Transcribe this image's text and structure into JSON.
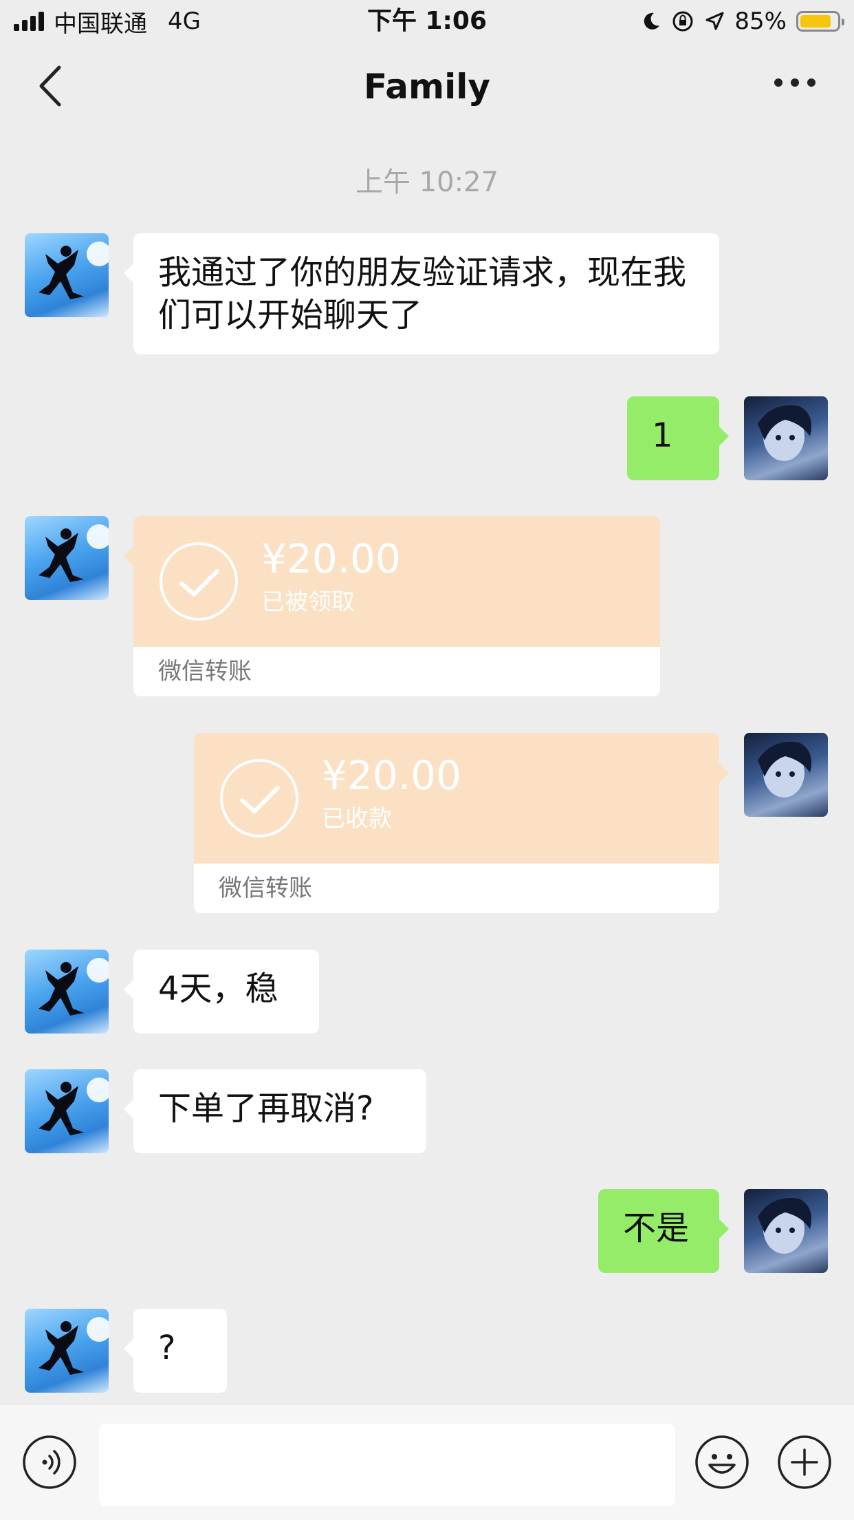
{
  "status_bar": {
    "carrier": "中国联通",
    "network": "4G",
    "time": "下午 1:06",
    "battery": "85%",
    "battery_level": 0.85,
    "icons": [
      "signal-icon",
      "moon-icon",
      "rotation-lock-icon",
      "location-icon",
      "battery-icon"
    ],
    "battery_color": "#f6c60d"
  },
  "nav": {
    "title": "Family",
    "back_icon": "chevron-left-icon",
    "more_icon": "more-icon"
  },
  "chat": {
    "timestamp": "上午 10:27",
    "messages": [
      {
        "from": "other",
        "type": "text",
        "text": "我通过了你的朋友验证请求，现在我们可以开始聊天了"
      },
      {
        "from": "me",
        "type": "text",
        "text": "1"
      },
      {
        "from": "other",
        "type": "transfer",
        "amount": "¥20.00",
        "status": "已被领取",
        "label": "微信转账"
      },
      {
        "from": "me",
        "type": "transfer",
        "amount": "¥20.00",
        "status": "已收款",
        "label": "微信转账"
      },
      {
        "from": "other",
        "type": "text",
        "text": "4天，稳"
      },
      {
        "from": "other",
        "type": "text",
        "text": "下单了再取消?"
      },
      {
        "from": "me",
        "type": "text",
        "text": "不是"
      },
      {
        "from": "other",
        "type": "text",
        "text": "?"
      }
    ]
  },
  "input_bar": {
    "voice_icon": "voice-icon",
    "emoji_icon": "emoji-icon",
    "plus_icon": "plus-icon",
    "text_value": ""
  },
  "colors": {
    "background": "#ededed",
    "bubble_in": "#ffffff",
    "bubble_out": "#95ec69",
    "transfer": "#fbe0c4"
  }
}
